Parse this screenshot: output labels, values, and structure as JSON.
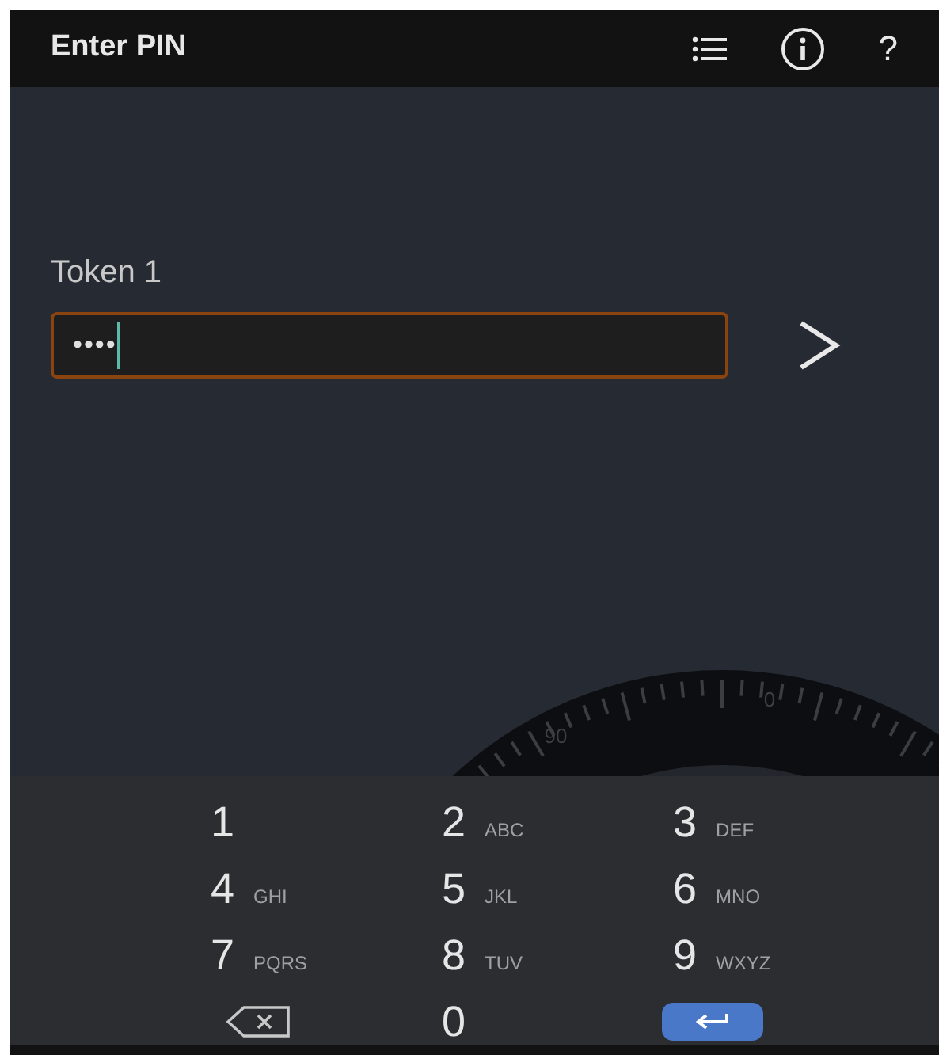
{
  "app_bar": {
    "title": "Enter PIN",
    "actions": [
      {
        "kind": "list"
      },
      {
        "kind": "info"
      },
      {
        "kind": "help",
        "label": "?"
      }
    ]
  },
  "pin_form": {
    "label": "Token 1",
    "value": "••••",
    "focused": true
  },
  "dial": {
    "labels": [
      "90",
      "0"
    ]
  },
  "keypad": {
    "keys": [
      {
        "kind": "digit",
        "digit": "1"
      },
      {
        "kind": "digit",
        "digit": "2",
        "letters": "ABC"
      },
      {
        "kind": "digit",
        "digit": "3",
        "letters": "DEF"
      },
      {
        "kind": "digit",
        "digit": "4",
        "letters": "GHI"
      },
      {
        "kind": "digit",
        "digit": "5",
        "letters": "JKL"
      },
      {
        "kind": "digit",
        "digit": "6",
        "letters": "MNO"
      },
      {
        "kind": "digit",
        "digit": "7",
        "letters": "PQRS"
      },
      {
        "kind": "digit",
        "digit": "8",
        "letters": "TUV"
      },
      {
        "kind": "digit",
        "digit": "9",
        "letters": "WXYZ"
      },
      {
        "kind": "backspace"
      },
      {
        "kind": "digit",
        "digit": "0"
      },
      {
        "kind": "enter"
      }
    ]
  }
}
